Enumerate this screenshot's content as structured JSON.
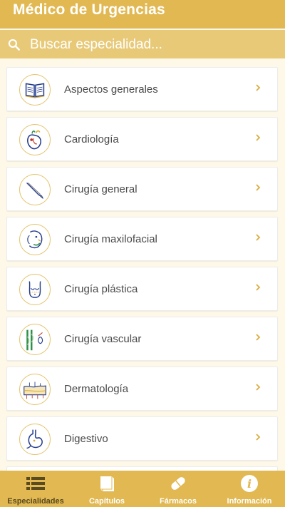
{
  "header": {
    "title": "Médico de Urgencias"
  },
  "search": {
    "placeholder": "Buscar especialidad...",
    "icon": "search-icon"
  },
  "specialties": [
    {
      "label": "Aspectos generales",
      "icon": "book-icon"
    },
    {
      "label": "Cardiología",
      "icon": "heart-icon"
    },
    {
      "label": "Cirugía general",
      "icon": "scalpel-icon"
    },
    {
      "label": "Cirugía maxilofacial",
      "icon": "face-icon"
    },
    {
      "label": "Cirugía plástica",
      "icon": "torso-icon"
    },
    {
      "label": "Cirugía vascular",
      "icon": "veins-icon"
    },
    {
      "label": "Dermatología",
      "icon": "skin-icon"
    },
    {
      "label": "Digestivo",
      "icon": "stomach-icon"
    }
  ],
  "bottom_nav": [
    {
      "label": "Especialidades",
      "icon": "list-icon",
      "active": true
    },
    {
      "label": "Capítulos",
      "icon": "book-icon",
      "active": false
    },
    {
      "label": "Fármacos",
      "icon": "pill-icon",
      "active": false
    },
    {
      "label": "Información",
      "icon": "info-icon",
      "active": false
    }
  ],
  "colors": {
    "primary": "#e1b851",
    "search_bg": "#e8c978",
    "background": "#fdf8e8",
    "active_tab": "#5a4a1f",
    "chevron": "#d9ae3f"
  }
}
